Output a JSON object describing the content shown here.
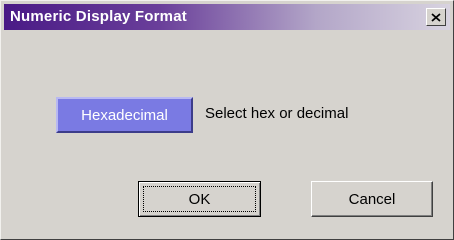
{
  "window": {
    "title": "Numeric Display Format",
    "close_icon": "close-icon"
  },
  "format": {
    "button_label": "Hexadecimal",
    "description": "Select hex or decimal",
    "button_color": "#7a7ae3"
  },
  "actions": {
    "ok_label": "OK",
    "cancel_label": "Cancel"
  }
}
